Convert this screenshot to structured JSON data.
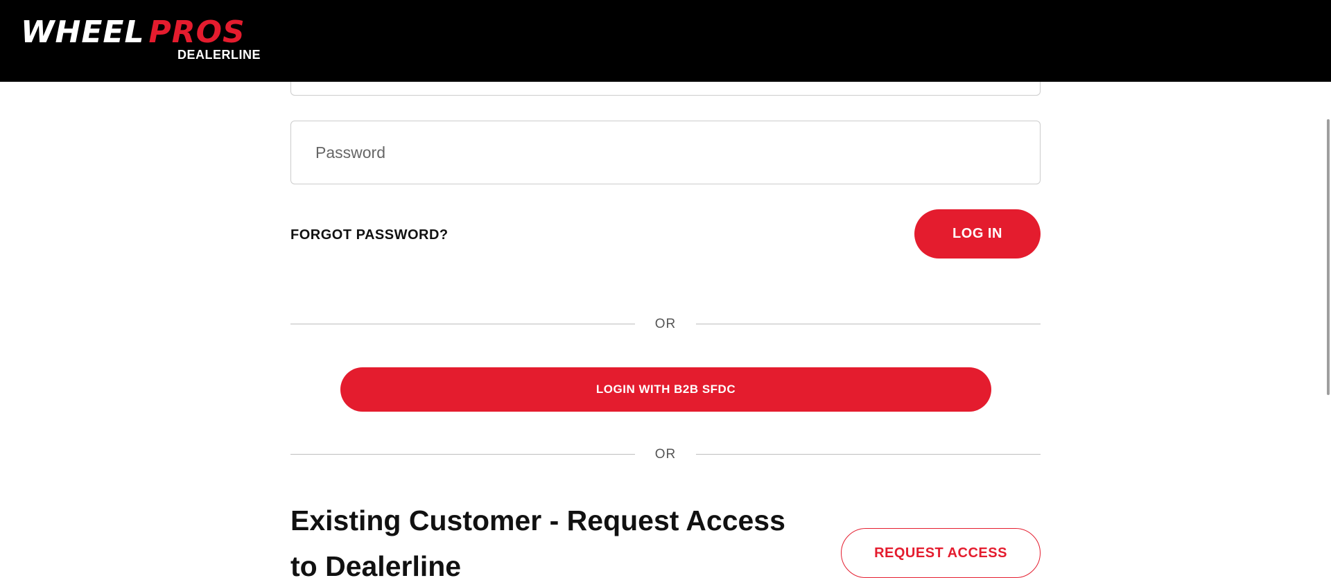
{
  "header": {
    "logo": {
      "wheel": "WHEEL",
      "pros": "PROS",
      "sub": "DEALERLINE"
    }
  },
  "login": {
    "password_placeholder": "Password",
    "forgot_password": "FORGOT PASSWORD?",
    "login_button": "LOG IN"
  },
  "dividers": {
    "or_label": "OR"
  },
  "sso": {
    "button_label": "LOGIN WITH B2B SFDC"
  },
  "request_access": {
    "title": "Existing Customer - Request Access to Dealerline",
    "button_label": "REQUEST ACCESS"
  },
  "colors": {
    "brand_red": "#e41c2e",
    "header_bg": "#000000"
  }
}
